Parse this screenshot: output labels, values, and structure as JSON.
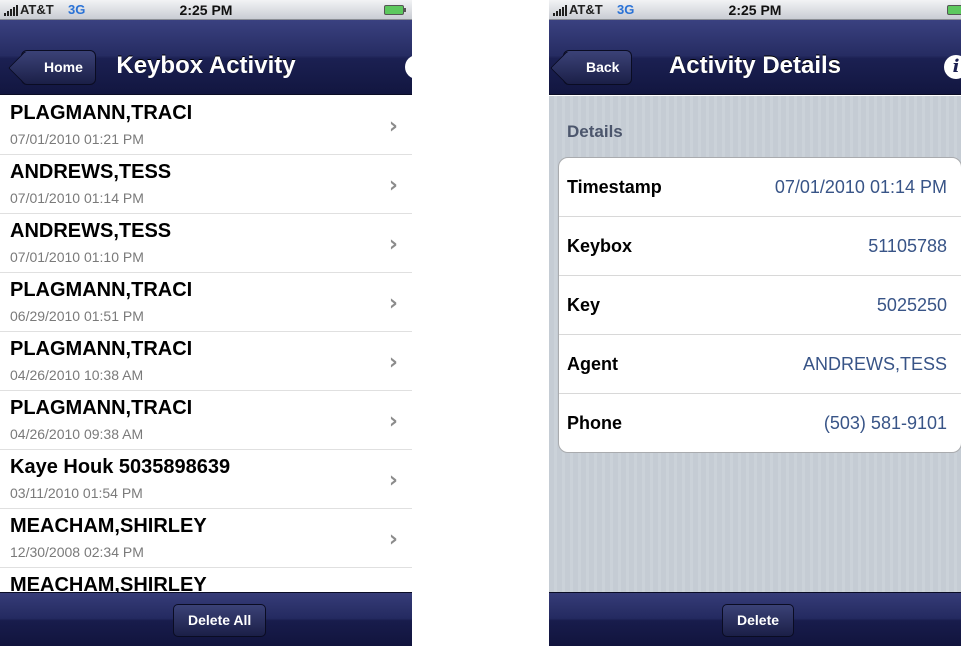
{
  "left_screen": {
    "status": {
      "carrier": "AT&T",
      "network": "3G",
      "time": "2:25 PM"
    },
    "nav": {
      "back_label": "Home",
      "title": "Keybox Activity",
      "info_icon": "info-icon"
    },
    "rows": [
      {
        "name": "PLAGMANN,TRACI",
        "date": "07/01/2010 01:21 PM"
      },
      {
        "name": "ANDREWS,TESS",
        "date": "07/01/2010 01:14 PM"
      },
      {
        "name": "ANDREWS,TESS",
        "date": "07/01/2010 01:10 PM"
      },
      {
        "name": "PLAGMANN,TRACI",
        "date": "06/29/2010 01:51 PM"
      },
      {
        "name": "PLAGMANN,TRACI",
        "date": "04/26/2010 10:38 AM"
      },
      {
        "name": "PLAGMANN,TRACI",
        "date": "04/26/2010 09:38 AM"
      },
      {
        "name": "Kaye Houk 5035898639",
        "date": "03/11/2010 01:54 PM"
      },
      {
        "name": "MEACHAM,SHIRLEY",
        "date": "12/30/2008 02:34 PM"
      },
      {
        "name": "MEACHAM,SHIRLEY",
        "date": ""
      }
    ],
    "toolbar": {
      "delete_all_label": "Delete All"
    }
  },
  "right_screen": {
    "status": {
      "carrier": "AT&T",
      "network": "3G",
      "time": "2:25 PM"
    },
    "nav": {
      "back_label": "Back",
      "title": "Activity Details",
      "info_icon": "info-icon"
    },
    "section_header": "Details",
    "details": [
      {
        "label": "Timestamp",
        "value": "07/01/2010 01:14 PM"
      },
      {
        "label": "Keybox",
        "value": "51105788"
      },
      {
        "label": "Key",
        "value": "5025250"
      },
      {
        "label": "Agent",
        "value": "ANDREWS,TESS"
      },
      {
        "label": "Phone",
        "value": "(503) 581-9101"
      }
    ],
    "toolbar": {
      "delete_label": "Delete"
    }
  },
  "colors": {
    "nav_bar": "#262c62",
    "detail_value": "#385487",
    "network_text": "#2a72d6",
    "pinstripe_bg": "#c5ccd4"
  }
}
